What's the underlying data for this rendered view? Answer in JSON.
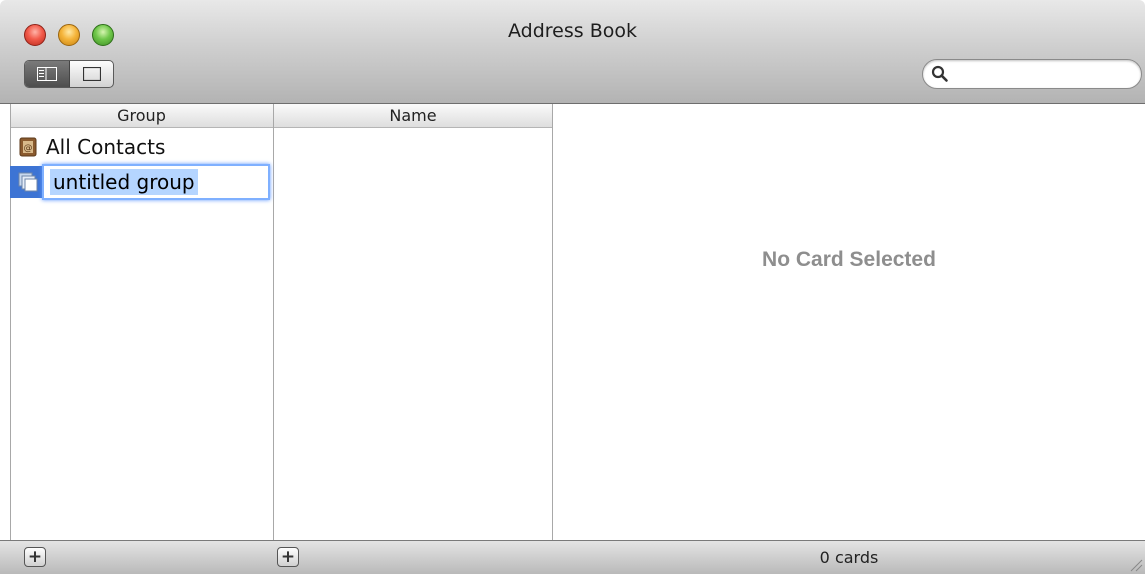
{
  "window": {
    "title": "Address Book"
  },
  "toolbar": {
    "search": {
      "value": "",
      "placeholder": ""
    }
  },
  "columns": {
    "group_header": "Group",
    "name_header": "Name"
  },
  "groups": [
    {
      "label": "All Contacts",
      "icon": "address-book-icon",
      "selected": false
    },
    {
      "label": "untitled group",
      "icon": "group-icon",
      "selected": true,
      "editing": true
    }
  ],
  "detail": {
    "empty_text": "No Card Selected"
  },
  "status": {
    "count_text": "0 cards"
  },
  "bottom": {
    "add_label": "+"
  },
  "colors": {
    "selection": "#3d74d4",
    "edit_highlight": "#b5d5ff",
    "close": "#f25a4a",
    "minimize": "#f5b43a",
    "zoom": "#6fc74a"
  }
}
